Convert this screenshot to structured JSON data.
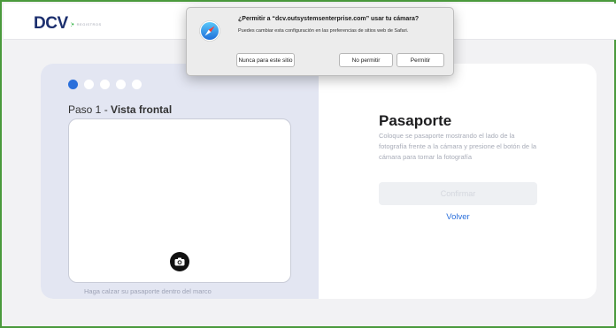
{
  "header": {
    "logo_text": "DCV",
    "logo_mark": ":•",
    "logo_sub": "REGISTROS"
  },
  "steps": {
    "count": 5,
    "active_index": 0
  },
  "left": {
    "step_prefix": "Paso 1 - ",
    "step_name": "Vista frontal",
    "hint": "Haga calzar su pasaporte dentro del marco"
  },
  "right": {
    "title": "Pasaporte",
    "description": "Coloque se pasaporte mostrando el lado de la fotografía frente a la cámara y presione el botón de la cámara para tomar la fotografía",
    "confirm_label": "Confirmar",
    "back_label": "Volver"
  },
  "dialog": {
    "title": "¿Permitir a “dcv.outsystemsenterprise.com” usar tu cámara?",
    "subtitle": "Puedes cambiar esta configuración en las preferencias de sitios web de Safari.",
    "never_label": "Nunca para este sitio",
    "deny_label": "No permitir",
    "allow_label": "Permitir"
  },
  "colors": {
    "accent": "#2a6fdb",
    "brand": "#1c2f6e",
    "brand_mark": "#39b54a",
    "panel_bg": "#e3e6f2",
    "frame_border": "#4a9a3c"
  },
  "icons": {
    "camera": "camera-icon",
    "safari": "safari-compass-icon"
  }
}
